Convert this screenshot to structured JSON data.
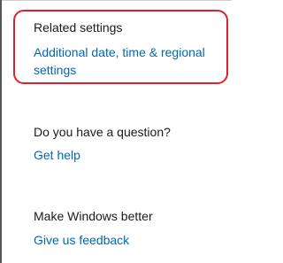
{
  "related": {
    "heading": "Related settings",
    "link": "Additional date, time & regional settings"
  },
  "question": {
    "heading": "Do you have a question?",
    "link": "Get help"
  },
  "feedback": {
    "heading": "Make Windows better",
    "link": "Give us feedback"
  },
  "colors": {
    "link": "#0067b8",
    "text": "#1a1a1a",
    "highlight": "#e0202a"
  }
}
